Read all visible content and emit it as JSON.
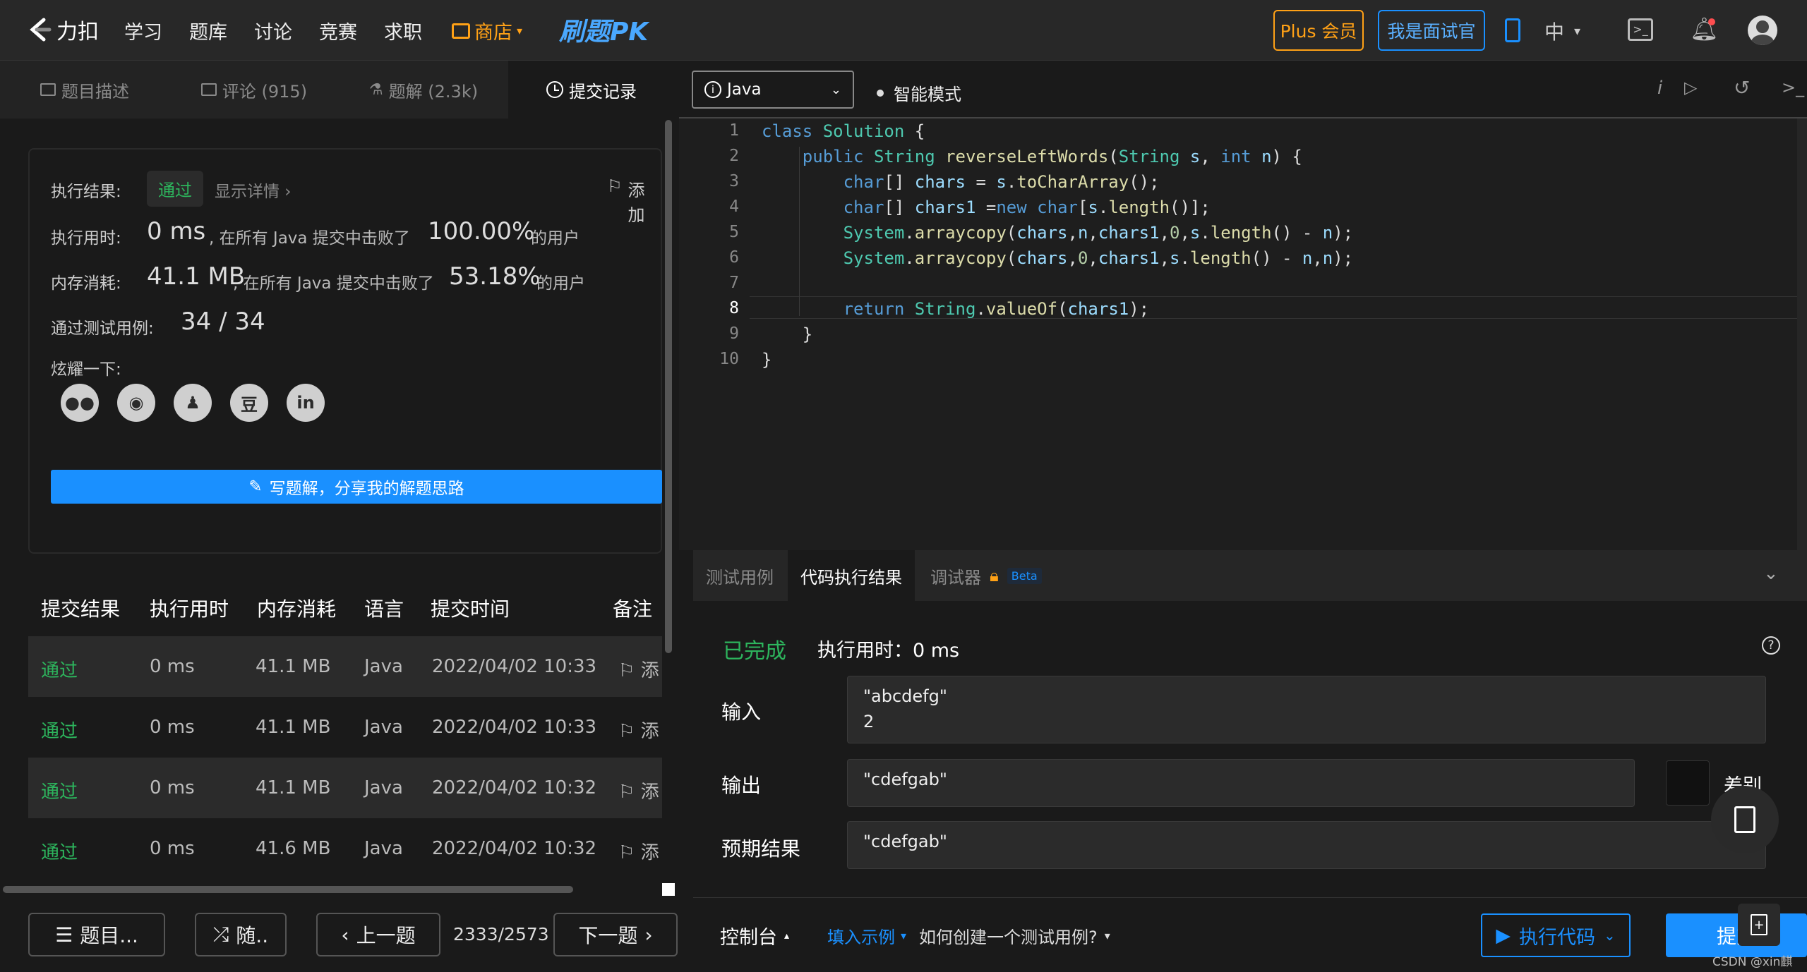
{
  "nav": {
    "logo": "力扣",
    "items": [
      "学习",
      "题库",
      "讨论",
      "竞赛",
      "求职"
    ],
    "store": "商店",
    "pk": "刷题PK",
    "plus": "Plus 会员",
    "interviewer": "我是面试官",
    "lang": "中"
  },
  "left_tabs": [
    {
      "label": "题目描述"
    },
    {
      "label": "评论 (915)"
    },
    {
      "label": "题解 (2.3k)"
    },
    {
      "label": "提交记录"
    }
  ],
  "result": {
    "status_label": "执行结果:",
    "status": "通过",
    "details": "显示详情",
    "add_note": "添加",
    "time_label": "执行用时:",
    "time_value": "0 ms",
    "time_mid": ", 在所有 Java 提交中击败了",
    "time_pct": "100.00%",
    "users": "的用户",
    "mem_label": "内存消耗:",
    "mem_value": "41.1 MB",
    "mem_mid": ", 在所有 Java 提交中击败了",
    "mem_pct": "53.18%",
    "tests_label": "通过测试用例:",
    "tests_value": "34 / 34",
    "share_label": "炫耀一下:",
    "share_icons": [
      "wechat-icon",
      "weibo-icon",
      "qq-icon",
      "douban-icon",
      "linkedin-icon"
    ],
    "write_solution": "写题解，分享我的解题思路"
  },
  "table": {
    "headers": [
      "提交结果",
      "执行用时",
      "内存消耗",
      "语言",
      "提交时间",
      "备注"
    ],
    "rows": [
      {
        "result": "通过",
        "time": "0 ms",
        "mem": "41.1 MB",
        "lang": "Java",
        "date": "2022/04/02 10:33",
        "note": "添"
      },
      {
        "result": "通过",
        "time": "0 ms",
        "mem": "41.1 MB",
        "lang": "Java",
        "date": "2022/04/02 10:33",
        "note": "添"
      },
      {
        "result": "通过",
        "time": "0 ms",
        "mem": "41.1 MB",
        "lang": "Java",
        "date": "2022/04/02 10:32",
        "note": "添"
      },
      {
        "result": "通过",
        "time": "0 ms",
        "mem": "41.6 MB",
        "lang": "Java",
        "date": "2022/04/02 10:32",
        "note": "添"
      }
    ]
  },
  "bottom_left": {
    "problems": "题目...",
    "random": "随..",
    "prev": "上一题",
    "counter": "2333/2573",
    "next": "下一题"
  },
  "editor": {
    "language": "Java",
    "smart_mode": "智能模式",
    "lines": [
      "class Solution {",
      "    public String reverseLeftWords(String s, int n) {",
      "        char[] chars = s.toCharArray();",
      "        char[] chars1 =new char[s.length()];",
      "        System.arraycopy(chars,n,chars1,0,s.length() - n);",
      "        System.arraycopy(chars,0,chars1,s.length() - n,n);",
      "",
      "        return String.valueOf(chars1);",
      "    }",
      "}"
    ]
  },
  "console": {
    "tabs": [
      "测试用例",
      "代码执行结果",
      "调试器"
    ],
    "beta": "Beta",
    "done": "已完成",
    "exec_time": "执行用时：0 ms",
    "input_label": "输入",
    "input_value": "\"abcdefg\"\n2",
    "output_label": "输出",
    "output_value": "\"cdefgab\"",
    "diff": "差别",
    "expected_label": "预期结果",
    "expected_value": "\"cdefgab\""
  },
  "bottom_right": {
    "console": "控制台",
    "fill_example": "填入示例",
    "how_to": "如何创建一个测试用例?",
    "run": "执行代码",
    "submit": "提交",
    "watermark": "CSDN @xin麒"
  },
  "colors": {
    "green": "#2db55d",
    "blue": "#1a90ff",
    "orange": "#ffa116"
  }
}
